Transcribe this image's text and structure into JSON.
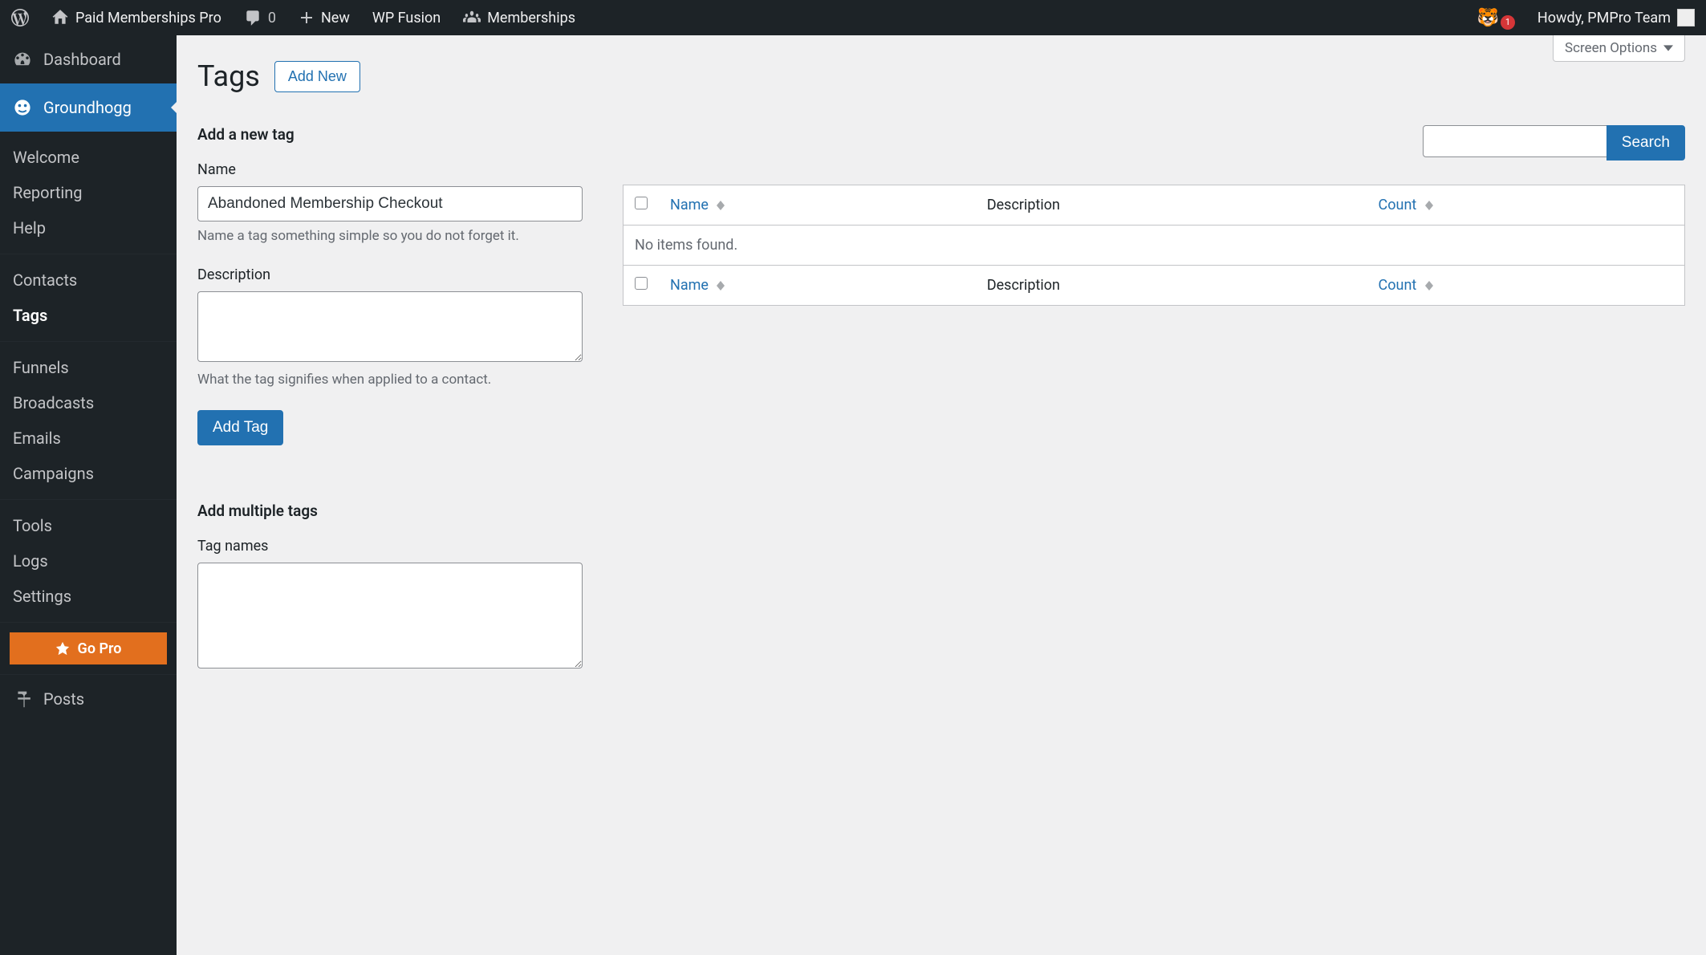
{
  "adminbar": {
    "site_name": "Paid Memberships Pro",
    "comments": "0",
    "new": "New",
    "wp_fusion": "WP Fusion",
    "memberships": "Memberships",
    "notif_count": "1",
    "howdy": "Howdy, PMPro Team"
  },
  "sidebar": {
    "dashboard": "Dashboard",
    "groundhogg": "Groundhogg",
    "submenu1": [
      "Welcome",
      "Reporting",
      "Help"
    ],
    "submenu2": [
      "Contacts",
      "Tags"
    ],
    "submenu3": [
      "Funnels",
      "Broadcasts",
      "Emails",
      "Campaigns"
    ],
    "submenu4": [
      "Tools",
      "Logs",
      "Settings"
    ],
    "go_pro": "Go Pro",
    "posts": "Posts"
  },
  "screen_options": "Screen Options",
  "page": {
    "title": "Tags",
    "add_new": "Add New"
  },
  "form": {
    "add_section": "Add a new tag",
    "name_label": "Name",
    "name_value": "Abandoned Membership Checkout",
    "name_help": "Name a tag something simple so you do not forget it.",
    "desc_label": "Description",
    "desc_value": "",
    "desc_help": "What the tag signifies when applied to a contact.",
    "submit": "Add Tag",
    "multi_section": "Add multiple tags",
    "multi_label": "Tag names",
    "multi_value": ""
  },
  "search": {
    "value": "",
    "button": "Search"
  },
  "table": {
    "col_name": "Name",
    "col_desc": "Description",
    "col_count": "Count",
    "empty": "No items found."
  }
}
